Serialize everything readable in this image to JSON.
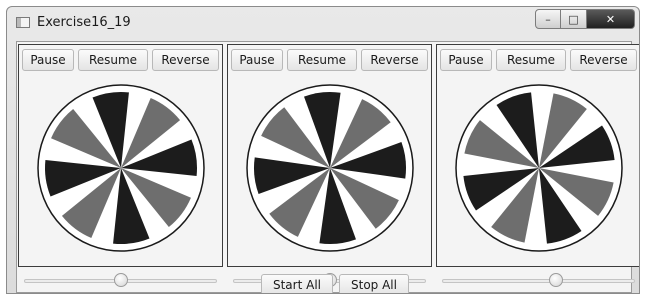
{
  "window": {
    "title": "Exercise16_19",
    "minimize": "–",
    "maximize": "□",
    "close": "✕"
  },
  "panes": [
    {
      "pause": "Pause",
      "resume": "Resume",
      "reverse": "Reverse",
      "rotation": -8,
      "slider_value": 0.5
    },
    {
      "pause": "Pause",
      "resume": "Resume",
      "reverse": "Reverse",
      "rotation": -6,
      "slider_value": 0.5
    },
    {
      "pause": "Pause",
      "resume": "Resume",
      "reverse": "Reverse",
      "rotation": -20,
      "slider_value": 0.6
    }
  ],
  "footer": {
    "start_all": "Start All",
    "stop_all": "Stop All"
  },
  "colors": {
    "blade_dark": "#1c1c1c",
    "blade_gray": "#6e6e6e",
    "fan_bg": "#ffffff"
  }
}
